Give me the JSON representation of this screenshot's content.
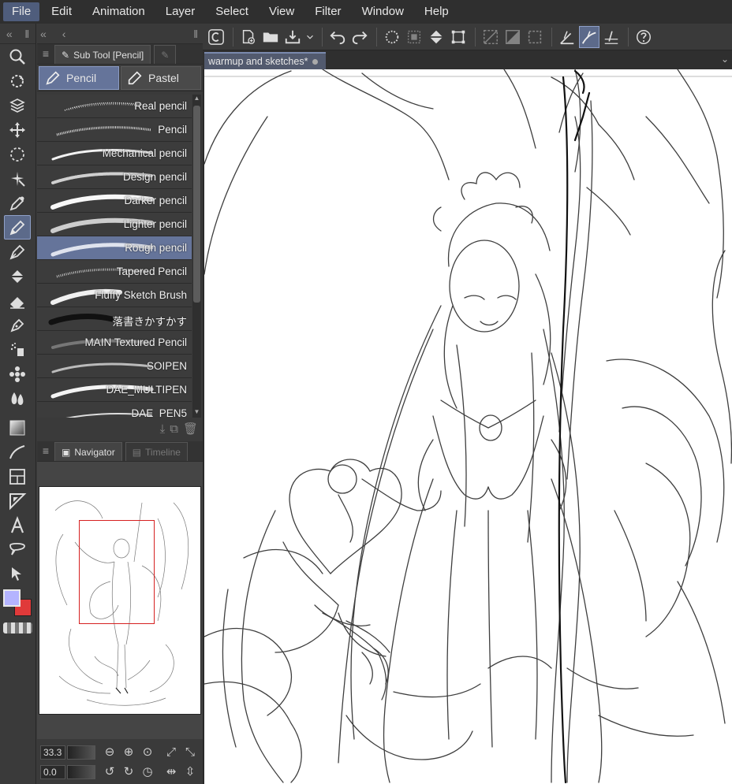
{
  "menu": [
    "File",
    "Edit",
    "Animation",
    "Layer",
    "Select",
    "View",
    "Filter",
    "Window",
    "Help"
  ],
  "subtool": {
    "tab_label": "Sub Tool [Pencil]",
    "groups": [
      "Pencil",
      "Pastel"
    ],
    "brushes": [
      "Real pencil",
      "Pencil",
      "Mechanical pencil",
      "Design pencil",
      "Darker pencil",
      "Lighter pencil",
      "Rough pencil",
      "Tapered Pencil",
      "Fluffy Sketch Brush",
      "落書きかすかす",
      "MAIN Textured Pencil",
      "SOIPEN",
      "DAE_MULTIPEN",
      "DAE_PEN5"
    ],
    "selected_brush": "Rough pencil"
  },
  "navigator": {
    "tabs": [
      "Navigator",
      "Timeline"
    ],
    "zoom": "33.3",
    "rotation": "0.0"
  },
  "canvas": {
    "tab_title": "warmup and sketches*"
  },
  "colors": {
    "main": "#b4b4ff",
    "sub": "#e03a3a",
    "accent": "#65749a"
  }
}
